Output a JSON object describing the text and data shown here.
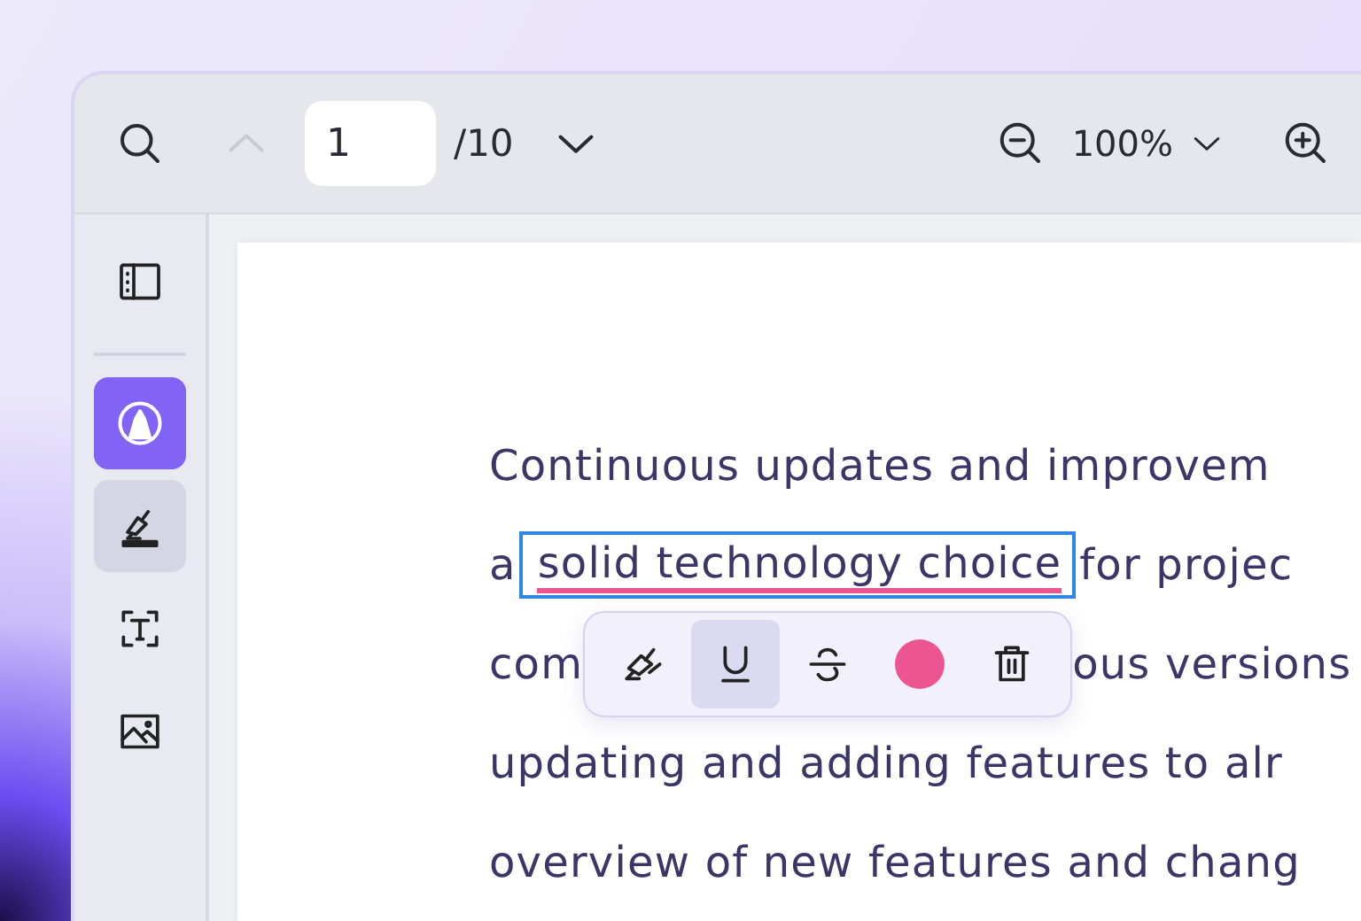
{
  "toolbar": {
    "page_up": {
      "disabled": true
    },
    "page_input": {
      "value": "1"
    },
    "page_total": "/10",
    "zoom": "100%"
  },
  "sidebar": {
    "items": [
      {
        "kind": "panel",
        "selected": false,
        "active": false
      },
      {
        "kind": "annotate",
        "selected": true,
        "active": false
      },
      {
        "kind": "highlight",
        "selected": false,
        "active": true
      },
      {
        "kind": "textbox",
        "selected": false,
        "active": false
      },
      {
        "kind": "image",
        "selected": false,
        "active": false
      }
    ]
  },
  "document": {
    "lines": [
      {
        "segments": [
          {
            "text": "Continuous updates and improvem",
            "kind": "plain"
          }
        ]
      },
      {
        "segments": [
          {
            "text": "a",
            "kind": "plain"
          },
          {
            "text": "solid technology choice",
            "kind": "annotated"
          },
          {
            "text": "for projec",
            "kind": "plain"
          }
        ]
      },
      {
        "segments": [
          {
            "text": "com",
            "kind": "plain"
          },
          {
            "kind": "popup"
          },
          {
            "text": "ous versions",
            "kind": "plain"
          }
        ]
      },
      {
        "segments": [
          {
            "text": "updating and adding features to alr",
            "kind": "plain"
          }
        ]
      },
      {
        "segments": [
          {
            "text": "overview of new features and chang",
            "kind": "plain"
          }
        ]
      }
    ]
  },
  "popup": {
    "tools": [
      {
        "kind": "highlight",
        "selected": false
      },
      {
        "kind": "underline",
        "selected": true
      },
      {
        "kind": "strikethrough",
        "selected": false
      },
      {
        "kind": "color",
        "color": "#ec5590"
      },
      {
        "kind": "delete",
        "selected": false
      }
    ]
  }
}
